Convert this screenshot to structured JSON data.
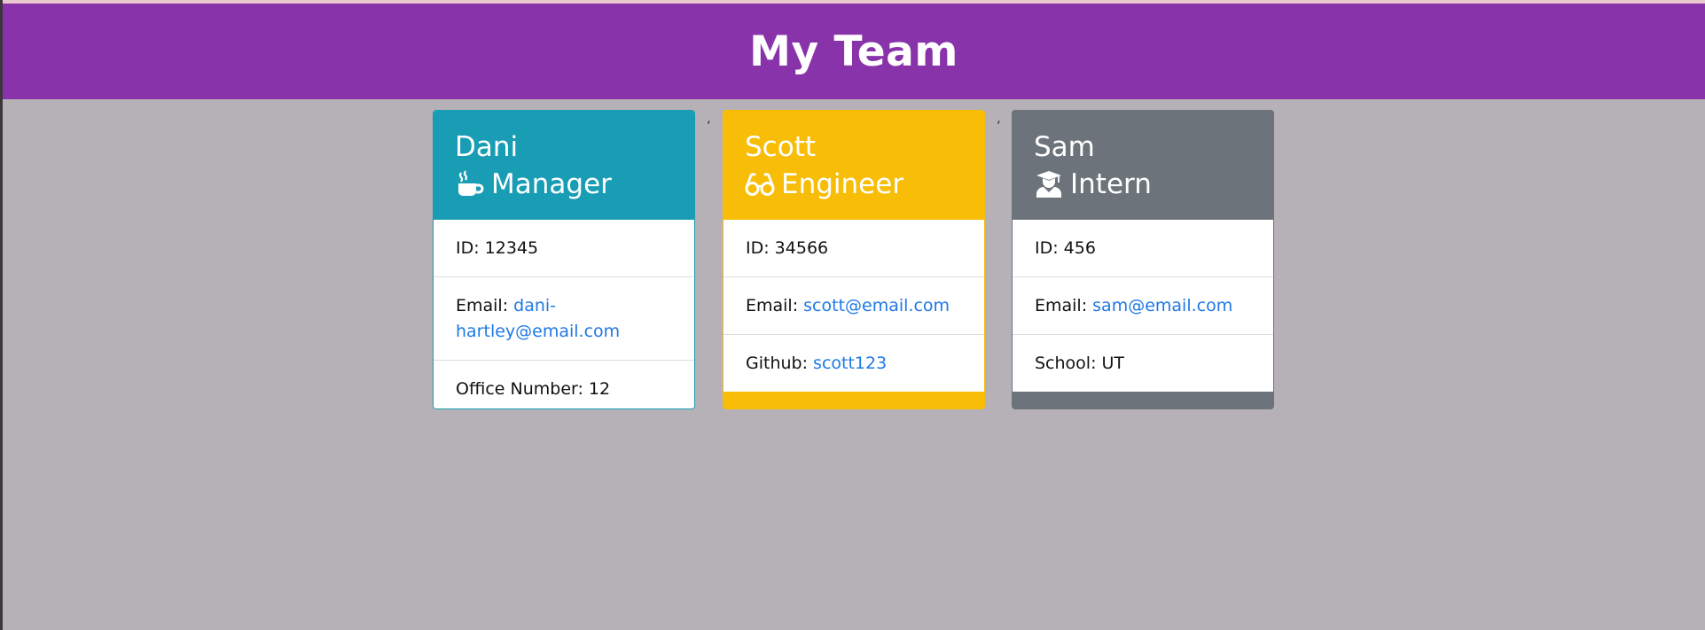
{
  "header": {
    "title": "My Team"
  },
  "separators": [
    ",",
    ","
  ],
  "employees": [
    {
      "name": "Dani",
      "role": "Manager",
      "icon": "coffee-icon",
      "color": "#189db4",
      "id_label": "ID: 12345",
      "email_label": "Email: ",
      "email": "dani-hartley@email.com",
      "extra_label": "Office Number: 12",
      "extra_link": ""
    },
    {
      "name": "Scott",
      "role": "Engineer",
      "icon": "glasses-icon",
      "color": "#f7bd07",
      "id_label": "ID: 34566",
      "email_label": "Email: ",
      "email": "scott@email.com",
      "extra_label": "Github: ",
      "extra_link": "scott123"
    },
    {
      "name": "Sam",
      "role": "Intern",
      "icon": "user-graduate-icon",
      "color": "#6c737b",
      "id_label": "ID: 456",
      "email_label": "Email: ",
      "email": "sam@email.com",
      "extra_label": "School: UT",
      "extra_link": ""
    }
  ]
}
